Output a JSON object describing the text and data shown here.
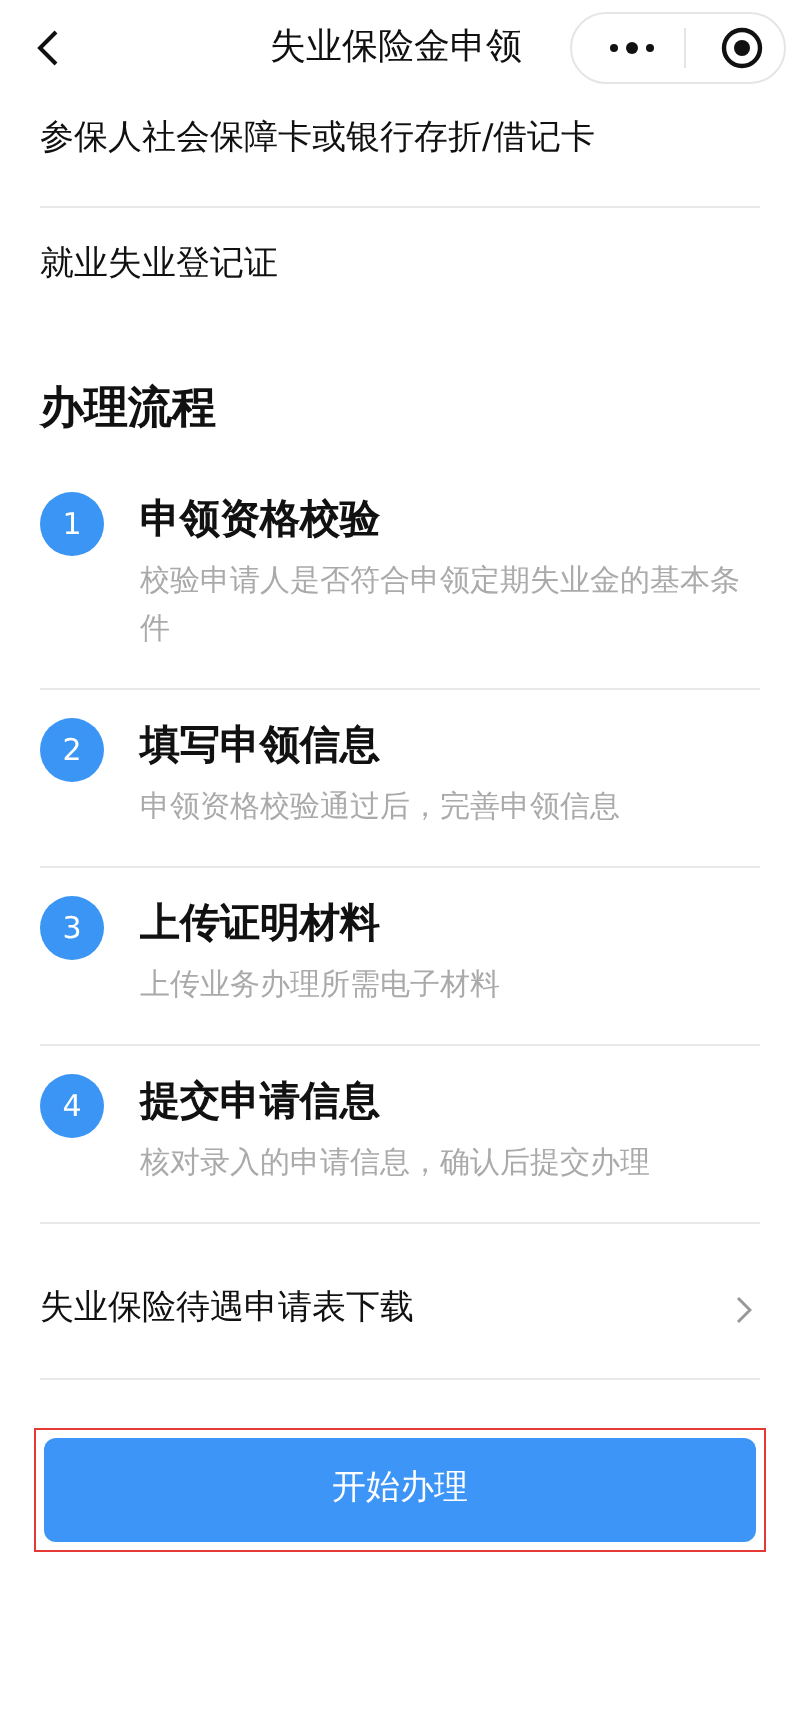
{
  "nav": {
    "title": "失业保险金申领"
  },
  "documents": [
    {
      "label": "参保人社会保障卡或银行存折/借记卡"
    },
    {
      "label": "就业失业登记证"
    }
  ],
  "process": {
    "title": "办理流程",
    "steps": [
      {
        "number": "1",
        "title": "申领资格校验",
        "description": "校验申请人是否符合申领定期失业金的基本条件"
      },
      {
        "number": "2",
        "title": "填写申领信息",
        "description": "申领资格校验通过后，完善申领信息"
      },
      {
        "number": "3",
        "title": "上传证明材料",
        "description": "上传业务办理所需电子材料"
      },
      {
        "number": "4",
        "title": "提交申请信息",
        "description": "核对录入的申请信息，确认后提交办理"
      }
    ]
  },
  "download_link": {
    "label": "失业保险待遇申请表下载"
  },
  "primary_button": {
    "label": "开始办理",
    "highlighted": true
  }
}
